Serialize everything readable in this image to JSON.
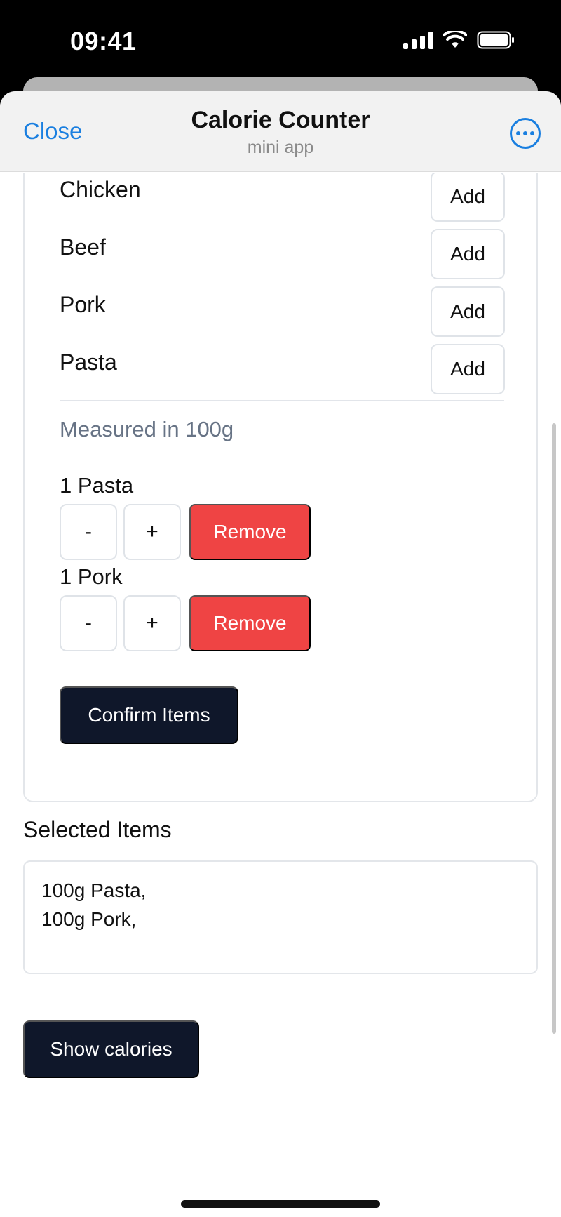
{
  "status_bar": {
    "time": "09:41"
  },
  "header": {
    "close_label": "Close",
    "title": "Calorie Counter",
    "subtitle": "mini app"
  },
  "foods": [
    {
      "name": "Chicken",
      "action": "Add"
    },
    {
      "name": "Beef",
      "action": "Add"
    },
    {
      "name": "Pork",
      "action": "Add"
    },
    {
      "name": "Pasta",
      "action": "Add"
    }
  ],
  "measure_note": "Measured in 100g",
  "cart": [
    {
      "label": "1 Pasta",
      "minus": "-",
      "plus": "+",
      "remove": "Remove"
    },
    {
      "label": "1 Pork",
      "minus": "-",
      "plus": "+",
      "remove": "Remove"
    }
  ],
  "confirm_label": "Confirm Items",
  "selected": {
    "title": "Selected Items",
    "lines": [
      "100g Pasta,",
      "100g Pork,"
    ]
  },
  "show_calories_label": "Show calories",
  "colors": {
    "accent": "#1a7fe0",
    "danger": "#ef4444",
    "dark_button": "#0f172a"
  }
}
